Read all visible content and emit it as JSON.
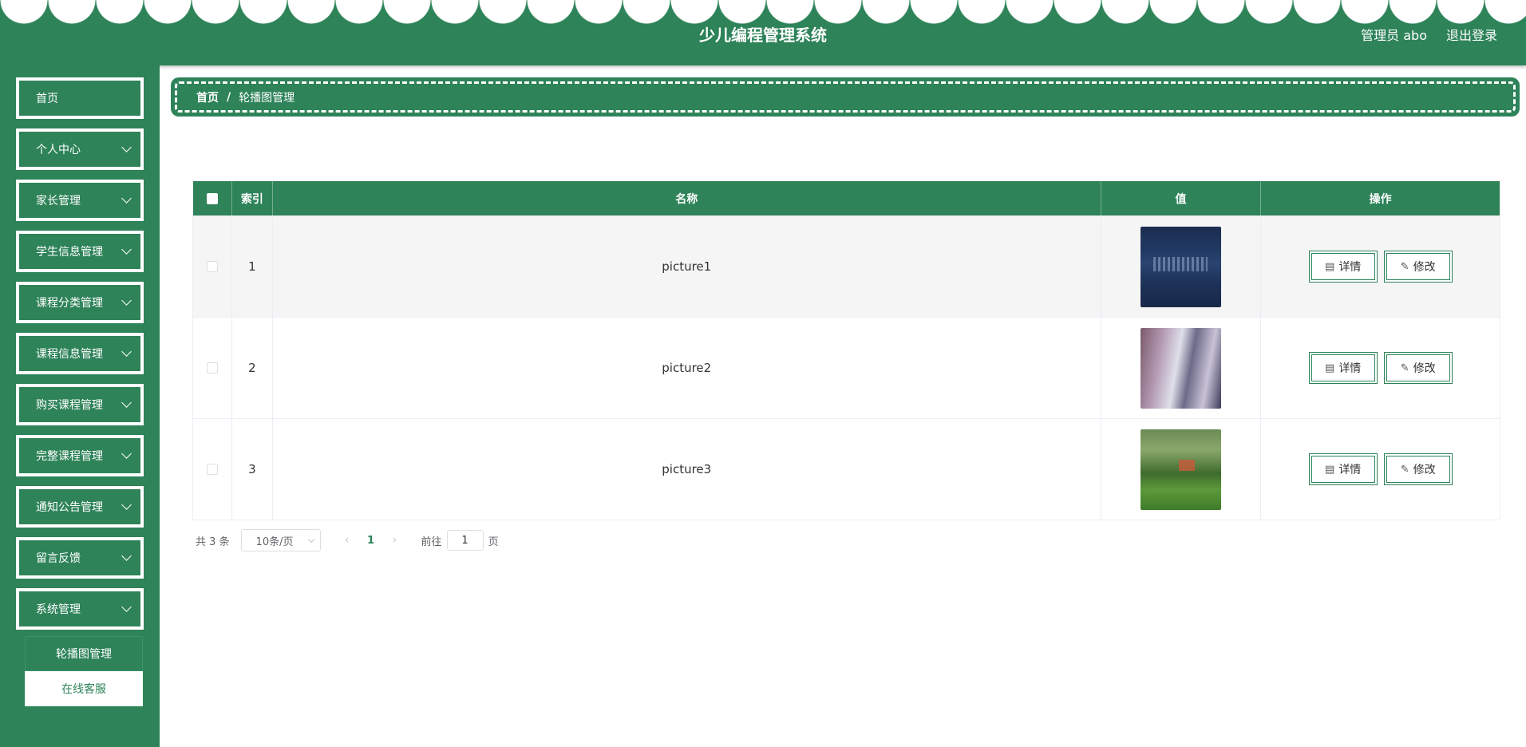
{
  "header": {
    "title": "少儿编程管理系统",
    "user_label": "管理员 abo",
    "logout_label": "退出登录"
  },
  "sidebar": {
    "items": [
      {
        "label": "首页"
      },
      {
        "label": "个人中心"
      },
      {
        "label": "家长管理"
      },
      {
        "label": "学生信息管理"
      },
      {
        "label": "课程分类管理"
      },
      {
        "label": "课程信息管理"
      },
      {
        "label": "购买课程管理"
      },
      {
        "label": "完整课程管理"
      },
      {
        "label": "通知公告管理"
      },
      {
        "label": "留言反馈"
      },
      {
        "label": "系统管理"
      }
    ],
    "submenu": [
      {
        "label": "轮播图管理",
        "active": true
      },
      {
        "label": "在线客服",
        "active": false
      }
    ]
  },
  "breadcrumb": {
    "home": "首页",
    "separator": "/",
    "current": "轮播图管理"
  },
  "table": {
    "columns": [
      "索引",
      "名称",
      "值",
      "操作"
    ],
    "rows": [
      {
        "index": "1",
        "name": "picture1",
        "value_image": "dark-blue-sign-photo"
      },
      {
        "index": "2",
        "name": "picture2",
        "value_image": "building-photo"
      },
      {
        "index": "3",
        "name": "picture3",
        "value_image": "park-lawn-photo"
      }
    ],
    "detail_label": "详情",
    "edit_label": "修改"
  },
  "pagination": {
    "total": "共 3 条",
    "page_size": "10条/页",
    "current_page": "1",
    "goto_prefix": "前往",
    "goto_value": "1",
    "goto_suffix": "页"
  },
  "colors": {
    "primary": "#2e8359",
    "header_bg": "#2e8359",
    "row_hover": "#f5f5f5"
  }
}
